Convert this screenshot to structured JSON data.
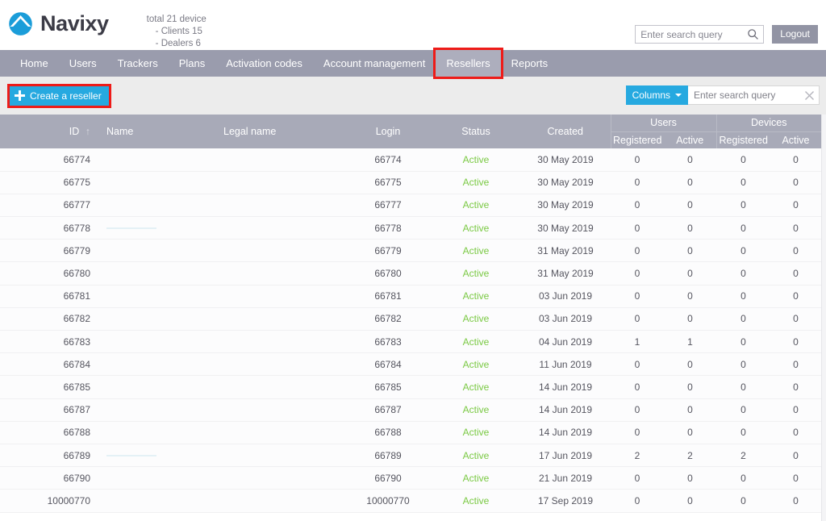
{
  "header": {
    "brand_name": "Navixy",
    "logo_icon": "navixy-logo-icon",
    "totals": {
      "line1": "total 21 device",
      "line2": "- Clients 15",
      "line3": "- Dealers 6"
    },
    "search": {
      "placeholder": "Enter search query",
      "value": "",
      "icon": "search-icon"
    },
    "logout_label": "Logout"
  },
  "nav": {
    "items": [
      {
        "label": "Home",
        "active": false,
        "highlighted": false
      },
      {
        "label": "Users",
        "active": false,
        "highlighted": false
      },
      {
        "label": "Trackers",
        "active": false,
        "highlighted": false
      },
      {
        "label": "Plans",
        "active": false,
        "highlighted": false
      },
      {
        "label": "Activation codes",
        "active": false,
        "highlighted": false
      },
      {
        "label": "Account management",
        "active": false,
        "highlighted": false
      },
      {
        "label": "Resellers",
        "active": true,
        "highlighted": true
      },
      {
        "label": "Reports",
        "active": false,
        "highlighted": false
      }
    ]
  },
  "toolbar": {
    "create_label": "Create a reseller",
    "create_icon": "plus-icon",
    "columns_label": "Columns",
    "columns_caret_icon": "chevron-down-icon",
    "search": {
      "placeholder": "Enter search query",
      "value": "",
      "clear_icon": "close-icon"
    }
  },
  "table": {
    "group_headers": [
      {
        "label": "Users",
        "span": 2
      },
      {
        "label": "Devices",
        "span": 2
      }
    ],
    "columns": [
      {
        "key": "id",
        "label": "ID",
        "sort": "asc",
        "sort_icon": "arrow-up-icon"
      },
      {
        "key": "name",
        "label": "Name"
      },
      {
        "key": "legal_name",
        "label": "Legal name"
      },
      {
        "key": "login",
        "label": "Login"
      },
      {
        "key": "status",
        "label": "Status"
      },
      {
        "key": "created",
        "label": "Created"
      },
      {
        "key": "users_registered",
        "label": "Registered"
      },
      {
        "key": "users_active",
        "label": "Active"
      },
      {
        "key": "devices_registered",
        "label": "Registered"
      },
      {
        "key": "devices_active",
        "label": "Active"
      }
    ],
    "rows": [
      {
        "id": "66774",
        "name": "",
        "legal_name": "",
        "login": "66774",
        "status": "Active",
        "created": "30 May 2019",
        "users_registered": "0",
        "users_active": "0",
        "devices_registered": "0",
        "devices_active": "0",
        "redacted_name": false
      },
      {
        "id": "66775",
        "name": "",
        "legal_name": "",
        "login": "66775",
        "status": "Active",
        "created": "30 May 2019",
        "users_registered": "0",
        "users_active": "0",
        "devices_registered": "0",
        "devices_active": "0",
        "redacted_name": false
      },
      {
        "id": "66777",
        "name": "",
        "legal_name": "",
        "login": "66777",
        "status": "Active",
        "created": "30 May 2019",
        "users_registered": "0",
        "users_active": "0",
        "devices_registered": "0",
        "devices_active": "0",
        "redacted_name": false
      },
      {
        "id": "66778",
        "name": "",
        "legal_name": "",
        "login": "66778",
        "status": "Active",
        "created": "30 May 2019",
        "users_registered": "0",
        "users_active": "0",
        "devices_registered": "0",
        "devices_active": "0",
        "redacted_name": true
      },
      {
        "id": "66779",
        "name": "",
        "legal_name": "",
        "login": "66779",
        "status": "Active",
        "created": "31 May 2019",
        "users_registered": "0",
        "users_active": "0",
        "devices_registered": "0",
        "devices_active": "0",
        "redacted_name": false
      },
      {
        "id": "66780",
        "name": "",
        "legal_name": "",
        "login": "66780",
        "status": "Active",
        "created": "31 May 2019",
        "users_registered": "0",
        "users_active": "0",
        "devices_registered": "0",
        "devices_active": "0",
        "redacted_name": false
      },
      {
        "id": "66781",
        "name": "",
        "legal_name": "",
        "login": "66781",
        "status": "Active",
        "created": "03 Jun 2019",
        "users_registered": "0",
        "users_active": "0",
        "devices_registered": "0",
        "devices_active": "0",
        "redacted_name": false
      },
      {
        "id": "66782",
        "name": "",
        "legal_name": "",
        "login": "66782",
        "status": "Active",
        "created": "03 Jun 2019",
        "users_registered": "0",
        "users_active": "0",
        "devices_registered": "0",
        "devices_active": "0",
        "redacted_name": false
      },
      {
        "id": "66783",
        "name": "",
        "legal_name": "",
        "login": "66783",
        "status": "Active",
        "created": "04 Jun 2019",
        "users_registered": "1",
        "users_active": "1",
        "devices_registered": "0",
        "devices_active": "0",
        "redacted_name": false
      },
      {
        "id": "66784",
        "name": "",
        "legal_name": "",
        "login": "66784",
        "status": "Active",
        "created": "11 Jun 2019",
        "users_registered": "0",
        "users_active": "0",
        "devices_registered": "0",
        "devices_active": "0",
        "redacted_name": false
      },
      {
        "id": "66785",
        "name": "",
        "legal_name": "",
        "login": "66785",
        "status": "Active",
        "created": "14 Jun 2019",
        "users_registered": "0",
        "users_active": "0",
        "devices_registered": "0",
        "devices_active": "0",
        "redacted_name": false
      },
      {
        "id": "66787",
        "name": "",
        "legal_name": "",
        "login": "66787",
        "status": "Active",
        "created": "14 Jun 2019",
        "users_registered": "0",
        "users_active": "0",
        "devices_registered": "0",
        "devices_active": "0",
        "redacted_name": false
      },
      {
        "id": "66788",
        "name": "",
        "legal_name": "",
        "login": "66788",
        "status": "Active",
        "created": "14 Jun 2019",
        "users_registered": "0",
        "users_active": "0",
        "devices_registered": "0",
        "devices_active": "0",
        "redacted_name": false
      },
      {
        "id": "66789",
        "name": "",
        "legal_name": "",
        "login": "66789",
        "status": "Active",
        "created": "17 Jun 2019",
        "users_registered": "2",
        "users_active": "2",
        "devices_registered": "2",
        "devices_active": "0",
        "redacted_name": true
      },
      {
        "id": "66790",
        "name": "",
        "legal_name": "",
        "login": "66790",
        "status": "Active",
        "created": "21 Jun 2019",
        "users_registered": "0",
        "users_active": "0",
        "devices_registered": "0",
        "devices_active": "0",
        "redacted_name": false
      },
      {
        "id": "10000770",
        "name": "",
        "legal_name": "",
        "login": "10000770",
        "status": "Active",
        "created": "17 Sep 2019",
        "users_registered": "0",
        "users_active": "0",
        "devices_registered": "0",
        "devices_active": "0",
        "redacted_name": false
      }
    ]
  },
  "colors": {
    "brand_blue": "#26a9e0",
    "nav_grey": "#9a9cad",
    "nav_active": "#adaebd",
    "header_grey": "#a8aab8",
    "status_green": "#7ac943",
    "highlight_red": "#ee1b18",
    "toolbar_bg": "#ececec"
  }
}
